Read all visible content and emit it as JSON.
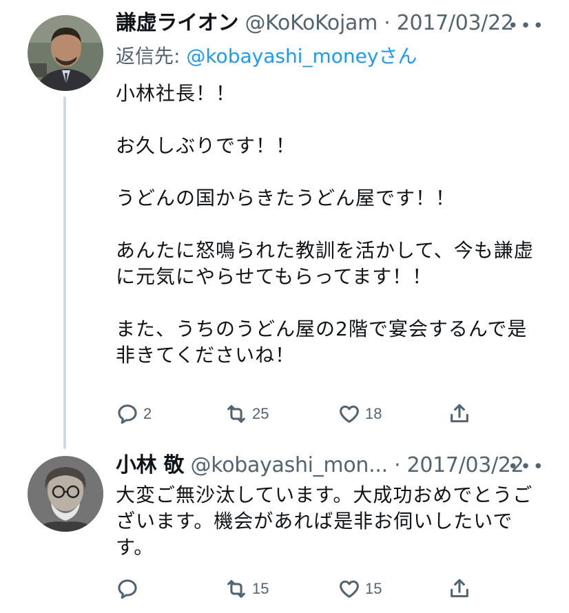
{
  "tweets": [
    {
      "author_name": "謙虚ライオン",
      "handle": "@KoKoKojam",
      "separator": "·",
      "date": "2017/03/22",
      "more_icon": "more-horizontal-icon",
      "replying_prefix": "返信先: ",
      "replying_handle": "@kobayashi_money",
      "replying_suffix": "さん",
      "paragraphs": [
        "小林社長！！",
        "お久しぶりです！！",
        "うどんの国からきたうどん屋です！！",
        "あんたに怒鳴られた教訓を活かして、今も謙虚に元気にやらせてもらってます！！",
        "また、うちのうどん屋の2階で宴会するんで是非きてくださいね！"
      ],
      "replies": "2",
      "retweets": "25",
      "likes": "18"
    },
    {
      "author_name": "小林 敬",
      "handle": "@kobayashi_mon...",
      "separator": "·",
      "date": "2017/03/22",
      "more_icon": "more-horizontal-icon",
      "paragraphs": [
        "大変ご無沙汰しています。大成功おめでとうございます。機会があれば是非お伺いしたいです。"
      ],
      "replies": "",
      "retweets": "15",
      "likes": "15"
    }
  ],
  "colors": {
    "text": "#0f1419",
    "secondary": "#536471",
    "link": "#1d9bf0",
    "thread_line": "#cfd9de"
  }
}
